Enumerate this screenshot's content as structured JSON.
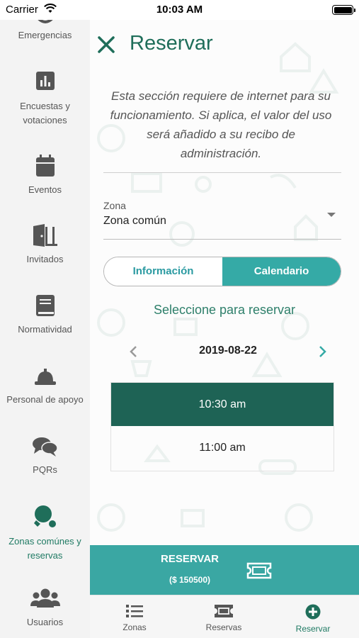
{
  "status_bar": {
    "carrier": "Carrier",
    "time": "10:03 AM"
  },
  "sidebar": {
    "items": [
      {
        "label": "Emergencias",
        "icon": "emergency-icon"
      },
      {
        "label": "Encuestas y votaciones",
        "icon": "bar-chart-icon"
      },
      {
        "label": "Eventos",
        "icon": "calendar-icon"
      },
      {
        "label": "Invitados",
        "icon": "door-icon"
      },
      {
        "label": "Normatividad",
        "icon": "book-icon"
      },
      {
        "label": "Personal de apoyo",
        "icon": "hard-hat-icon"
      },
      {
        "label": "PQRs",
        "icon": "chat-bubbles-icon"
      },
      {
        "label": "Zonas comúnes y reservas",
        "icon": "ping-pong-icon",
        "active": true
      },
      {
        "label": "Usuarios",
        "icon": "users-icon"
      }
    ]
  },
  "header": {
    "title": "Reservar",
    "close_icon": "close-icon"
  },
  "notice": "Esta sección requiere de internet para su funcionamiento. Si aplica, el valor del uso será añadido a su recibo de administración.",
  "zone": {
    "label": "Zona",
    "value": "Zona común"
  },
  "tabs": {
    "info": "Información",
    "calendar": "Calendario",
    "active": "calendar"
  },
  "calendar": {
    "hint": "Seleccione para reservar",
    "date": "2019-08-22",
    "slots": [
      {
        "time": "10:30 am",
        "selected": true
      },
      {
        "time": "11:00 am",
        "selected": false
      }
    ]
  },
  "reserve_button": {
    "label": "RESERVAR",
    "price": "($ 150500)",
    "icon": "ticket-icon"
  },
  "bottom_nav": {
    "items": [
      {
        "label": "Zonas",
        "icon": "list-icon"
      },
      {
        "label": "Reservas",
        "icon": "ticket-icon"
      },
      {
        "label": "Reservar",
        "icon": "plus-circle-icon",
        "active": true
      }
    ]
  },
  "colors": {
    "primary_dark": "#1e6355",
    "accent_teal": "#35aaa6",
    "title_green": "#1f6e5a",
    "active_label": "#1f7a63"
  }
}
